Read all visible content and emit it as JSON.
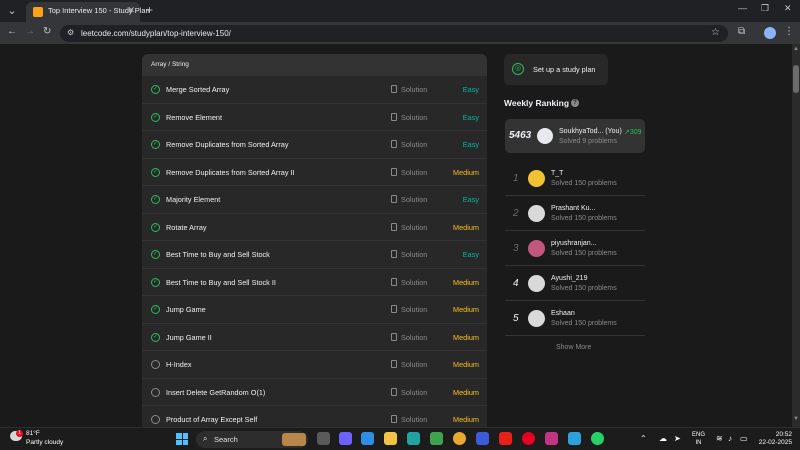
{
  "browser": {
    "tab_title": "Top Interview 150 - Study Plan",
    "url": "leetcode.com/studyplan/top-interview-150/"
  },
  "list": {
    "section": "Array / String",
    "solution_label": "Solution",
    "questions": [
      {
        "title": "Merge Sorted Array",
        "difficulty": "Easy",
        "solved": true
      },
      {
        "title": "Remove Element",
        "difficulty": "Easy",
        "solved": true
      },
      {
        "title": "Remove Duplicates from Sorted Array",
        "difficulty": "Easy",
        "solved": true
      },
      {
        "title": "Remove Duplicates from Sorted Array II",
        "difficulty": "Medium",
        "solved": true
      },
      {
        "title": "Majority Element",
        "difficulty": "Easy",
        "solved": true
      },
      {
        "title": "Rotate Array",
        "difficulty": "Medium",
        "solved": true
      },
      {
        "title": "Best Time to Buy and Sell Stock",
        "difficulty": "Easy",
        "solved": true
      },
      {
        "title": "Best Time to Buy and Sell Stock II",
        "difficulty": "Medium",
        "solved": true
      },
      {
        "title": "Jump Game",
        "difficulty": "Medium",
        "solved": true
      },
      {
        "title": "Jump Game II",
        "difficulty": "Medium",
        "solved": true
      },
      {
        "title": "H-Index",
        "difficulty": "Medium",
        "solved": false
      },
      {
        "title": "Insert Delete GetRandom O(1)",
        "difficulty": "Medium",
        "solved": false
      },
      {
        "title": "Product of Array Except Self",
        "difficulty": "Medium",
        "solved": false
      }
    ]
  },
  "sidebar": {
    "study_plan_label": "Set up a study plan",
    "weekly_ranking_title": "Weekly Ranking",
    "me": {
      "rank": "5463",
      "name": "SoukhyaTod... (You)",
      "change": "↗309",
      "solved": "Solved 9 problems"
    },
    "ranking": [
      {
        "rank": "1",
        "name": "T_T",
        "solved": "Solved 150 problems",
        "avatar_color": "#f1c232",
        "rank_color": "#6b6b6b"
      },
      {
        "rank": "2",
        "name": "Prashant Ku...",
        "solved": "Solved 150 problems",
        "avatar_color": "#d9d9d9",
        "rank_color": "#6b6b6b"
      },
      {
        "rank": "3",
        "name": "piyushranjan...",
        "solved": "Solved 150 problems",
        "avatar_color": "#c2577e",
        "rank_color": "#6b6b6b"
      },
      {
        "rank": "4",
        "name": "Ayushi_219",
        "solved": "Solved 150 problems",
        "avatar_color": "#d9d9d9",
        "rank_color": "#eff1f6"
      },
      {
        "rank": "5",
        "name": "Eshaan",
        "solved": "Solved 150 problems",
        "avatar_color": "#d9d9d9",
        "rank_color": "#eff1f6"
      }
    ],
    "show_more": "Show More"
  },
  "taskbar": {
    "temperature": "81°F",
    "weather": "Partly cloudy",
    "weather_badge": "1",
    "search_label": "Search",
    "lang_line1": "ENG",
    "lang_line2": "IN",
    "time": "20:52",
    "date": "22-02-2025"
  },
  "colors": {
    "easy": "#00b8a3",
    "medium": "#ffc01e",
    "solved_check": "#2cbb5d",
    "accent": "#ffa116"
  }
}
